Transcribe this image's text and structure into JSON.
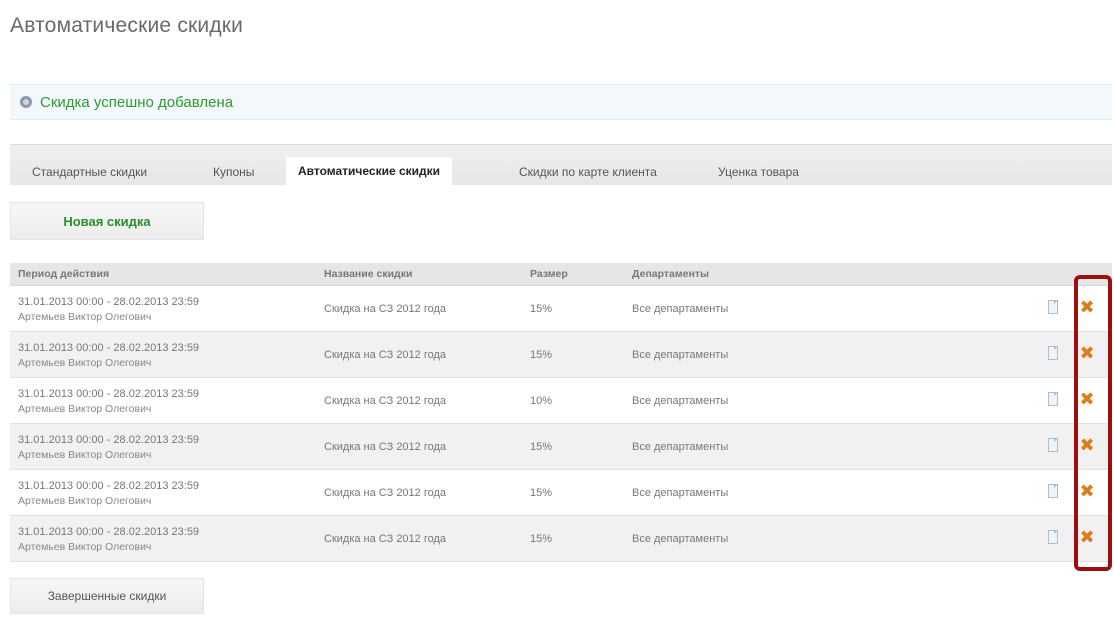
{
  "page": {
    "title": "Автоматические скидки"
  },
  "notice": {
    "message": "Скидка успешно добавлена"
  },
  "tabs": [
    {
      "label": "Стандартные скидки",
      "active": false
    },
    {
      "label": "Купоны",
      "active": false
    },
    {
      "label": "Автоматические скидки",
      "active": true
    },
    {
      "label": "Скидки по карте клиента",
      "active": false
    },
    {
      "label": "Уценка товара",
      "active": false
    }
  ],
  "buttons": {
    "new_discount": "Новая скидка",
    "finished_discounts": "Завершенные скидки"
  },
  "table": {
    "headers": [
      "Период действия",
      "Название скидки",
      "Размер",
      "Департаменты"
    ],
    "rows": [
      {
        "period": "31.01.2013 00:00 - 28.02.2013 23:59",
        "person": "Артемьев Виктор Олегович",
        "name": "Скидка на СЗ 2012 года",
        "size": "15%",
        "departments": "Все департаменты"
      },
      {
        "period": "31.01.2013 00:00 - 28.02.2013 23:59",
        "person": "Артемьев Виктор Олегович",
        "name": "Скидка на СЗ 2012 года",
        "size": "15%",
        "departments": "Все департаменты"
      },
      {
        "period": "31.01.2013 00:00 - 28.02.2013 23:59",
        "person": "Артемьев Виктор Олегович",
        "name": "Скидка на СЗ 2012 года",
        "size": "10%",
        "departments": "Все департаменты"
      },
      {
        "period": "31.01.2013 00:00 - 28.02.2013 23:59",
        "person": "Артемьев Виктор Олегович",
        "name": "Скидка на СЗ 2012 года",
        "size": "15%",
        "departments": "Все департаменты"
      },
      {
        "period": "31.01.2013 00:00 - 28.02.2013 23:59",
        "person": "Артемьев Виктор Олегович",
        "name": "Скидка на СЗ 2012 года",
        "size": "15%",
        "departments": "Все департаменты"
      },
      {
        "period": "31.01.2013 00:00 - 28.02.2013 23:59",
        "person": "Артемьев Виктор Олегович",
        "name": "Скидка на СЗ 2012 года",
        "size": "15%",
        "departments": "Все департаменты"
      }
    ]
  },
  "icons": {
    "edit": "edit-icon",
    "delete": "delete-icon",
    "info": "info-icon"
  },
  "colors": {
    "success": "#2e9a2e",
    "delete": "#e07b1a",
    "highlight": "#9b0f12"
  }
}
